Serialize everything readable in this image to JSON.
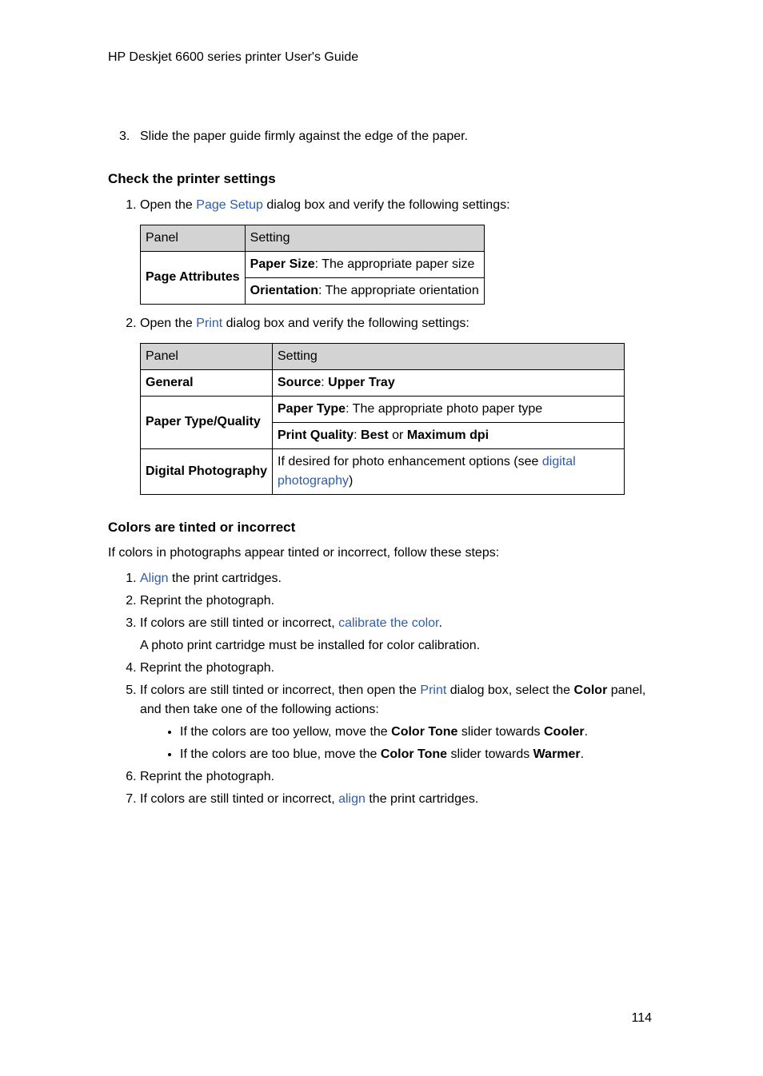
{
  "header": "HP Deskjet 6600 series printer User's Guide",
  "step3": "Slide the paper guide firmly against the edge of the paper.",
  "section1": {
    "title": "Check the printer settings",
    "step1": {
      "prefix": "Open the ",
      "link": "Page Setup",
      "suffix": " dialog box and verify the following settings:"
    },
    "table1": {
      "headers": [
        "Panel",
        "Setting"
      ],
      "panel": "Page Attributes",
      "row1": {
        "bold": "Paper Size",
        "rest": ": The appropriate paper size"
      },
      "row2": {
        "bold": "Orientation",
        "rest": ": The appropriate orientation"
      }
    },
    "step2": {
      "prefix": "Open the ",
      "link": "Print",
      "suffix": " dialog box and verify the following settings:"
    },
    "table2": {
      "headers": [
        "Panel",
        "Setting"
      ],
      "rows": [
        {
          "panel": "General",
          "s1bold": "Source",
          "s1mid": ": ",
          "s1bold2": "Upper Tray"
        },
        {
          "panel": "Paper Type/Quality",
          "a_bold": "Paper Type",
          "a_rest": ": The appropriate photo paper type",
          "b_bold": "Print Quality",
          "b_mid": ": ",
          "b_bold2": "Best",
          "b_or": " or ",
          "b_bold3": "Maximum dpi"
        },
        {
          "panel": "Digital Photography",
          "c_pre": "If desired for photo enhancement options (see ",
          "c_link": "digital photography",
          "c_post": ")"
        }
      ]
    }
  },
  "section2": {
    "title": "Colors are tinted or incorrect",
    "intro": "If colors in photographs appear tinted or incorrect, follow these steps:",
    "steps": {
      "s1": {
        "link": "Align",
        "rest": " the print cartridges."
      },
      "s2": "Reprint the photograph.",
      "s3": {
        "pre": "If colors are still tinted or incorrect, ",
        "link": "calibrate the color",
        "post": "."
      },
      "s3b": "A photo print cartridge must be installed for color calibration.",
      "s4": "Reprint the photograph.",
      "s5": {
        "pre": "If colors are still tinted or incorrect, then open the ",
        "link": "Print",
        "mid": " dialog box, select the ",
        "bold": "Color",
        "post": " panel, and then take one of the following actions:"
      },
      "s5a": {
        "pre": "If the colors are too yellow, move the ",
        "b1": "Color Tone",
        "mid": " slider towards ",
        "b2": "Cooler",
        "post": "."
      },
      "s5b": {
        "pre": "If the colors are too blue, move the ",
        "b1": "Color Tone",
        "mid": " slider towards ",
        "b2": "Warmer",
        "post": "."
      },
      "s6": "Reprint the photograph.",
      "s7": {
        "pre": "If colors are still tinted or incorrect, ",
        "link": "align",
        "post": " the print cartridges."
      }
    }
  },
  "pageNumber": "114"
}
